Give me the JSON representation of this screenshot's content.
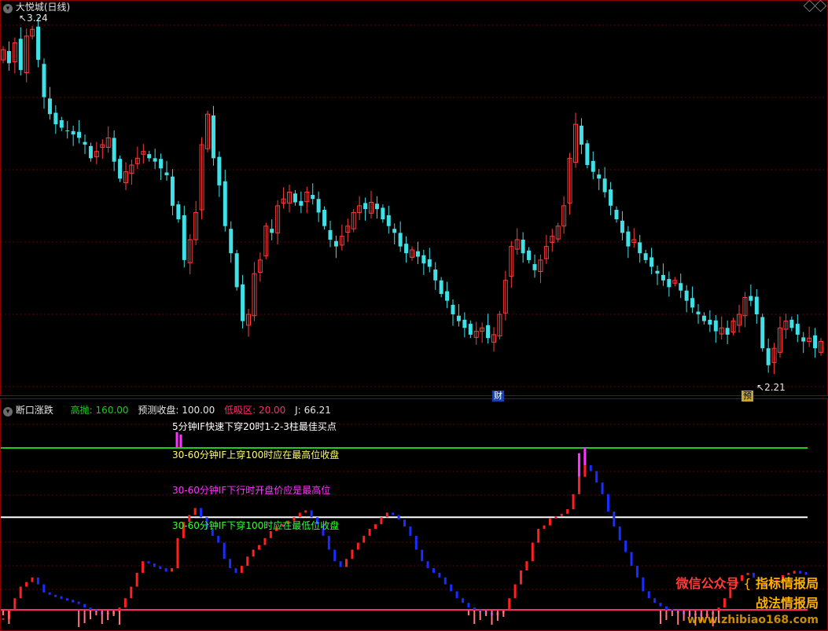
{
  "main_panel": {
    "title": "大悦城(日线)",
    "high_label": "3.24",
    "low_label": "2.21",
    "markers": [
      "财",
      "预"
    ]
  },
  "indicator_panel": {
    "title": "断口涨跌",
    "legend": [
      {
        "label": "高抛:",
        "value": "160.00",
        "color": "#1ecb1e"
      },
      {
        "label": "预测收盘:",
        "value": "100.00",
        "color": "#e6e6e6"
      },
      {
        "label": "低吸区:",
        "value": "20.00",
        "color": "#ff2a6e"
      },
      {
        "label": "J:",
        "value": "66.21",
        "color": "#e6e6e6"
      }
    ],
    "annotations": [
      {
        "text": "5分钟IF快速下穿20时1-2-3柱最佳买点",
        "color": "#ffffff"
      },
      {
        "text": "30-60分钟IF上穿100时应在最高位收盘",
        "color": "#ffff66"
      },
      {
        "text": "30-60分钟IF下行时开盘价应是最高位",
        "color": "#ff33ff"
      },
      {
        "text": "30-60分钟IF下穿100时应在最低位收盘",
        "color": "#33ff33"
      }
    ]
  },
  "watermark": {
    "line1_left": "微信公众号",
    "line1_right": "指标情报局",
    "line2": "战法情报局",
    "site": "www.zhibiao168.com"
  },
  "colors": {
    "up": "#ff3b3b",
    "down": "#3fe0e6",
    "panel_border": "#8b0000",
    "grid": "#6a0000"
  },
  "chart_data": [
    {
      "type": "candlestick",
      "title": "大悦城(日线)",
      "annotations": [
        "3.24",
        "2.21"
      ],
      "price_range": [
        2.18,
        3.28
      ],
      "series": [
        {
          "values": [
            3.18,
            3.14,
            3.2,
            3.12,
            3.22,
            3.24,
            3.15,
            3.04,
            2.99,
            2.96,
            2.95,
            2.94,
            2.93,
            2.92,
            2.9,
            2.86,
            2.88,
            2.9,
            2.92,
            2.85,
            2.8,
            2.82,
            2.84,
            2.86,
            2.88,
            2.86,
            2.85,
            2.83,
            2.81,
            2.72,
            2.68,
            2.56,
            2.62,
            2.7,
            2.9,
            2.99,
            2.86,
            2.78,
            2.66,
            2.58,
            2.48,
            2.38,
            2.4,
            2.52,
            2.56,
            2.66,
            2.64,
            2.72,
            2.74,
            2.76,
            2.73,
            2.72,
            2.76,
            2.74,
            2.7,
            2.66,
            2.62,
            2.6,
            2.63,
            2.66,
            2.7,
            2.72,
            2.71,
            2.73,
            2.71,
            2.68,
            2.66,
            2.64,
            2.6,
            2.58,
            2.59,
            2.57,
            2.55,
            2.54,
            2.5,
            2.46,
            2.44,
            2.4,
            2.38,
            2.36,
            2.34,
            2.35,
            2.36,
            2.33,
            2.34,
            2.4,
            2.5,
            2.6,
            2.62,
            2.58,
            2.56,
            2.53,
            2.56,
            2.6,
            2.63,
            2.66,
            2.72,
            2.86,
            2.96,
            2.9,
            2.84,
            2.82,
            2.8,
            2.76,
            2.72,
            2.68,
            2.64,
            2.6,
            2.62,
            2.58,
            2.56,
            2.54,
            2.52,
            2.5,
            2.48,
            2.5,
            2.47,
            2.44,
            2.42,
            2.4,
            2.38,
            2.37,
            2.35,
            2.36,
            2.34,
            2.38,
            2.4,
            2.45,
            2.44,
            2.4,
            2.3,
            2.25,
            2.3,
            2.36,
            2.38,
            2.36,
            2.34,
            2.32,
            2.33,
            2.3,
            2.32
          ]
        }
      ]
    },
    {
      "type": "bar",
      "title": "断口涨跌",
      "reference_lines": [
        160,
        100,
        20
      ],
      "series": [
        {
          "name": "J",
          "values": [
            12,
            20,
            30,
            40,
            44,
            48,
            42,
            35,
            33,
            31,
            30,
            28,
            27,
            25,
            22,
            20,
            18,
            17,
            17,
            18,
            22,
            30,
            40,
            52,
            62,
            60,
            57,
            56,
            53,
            56,
            82,
            96,
            102,
            108,
            100,
            90,
            84,
            78,
            64,
            56,
            52,
            58,
            66,
            72,
            76,
            82,
            88,
            92,
            94,
            97,
            100,
            104,
            106,
            100,
            94,
            84,
            72,
            62,
            57,
            64,
            72,
            78,
            84,
            90,
            94,
            100,
            104,
            102,
            98,
            92,
            84,
            72,
            62,
            56,
            52,
            48,
            42,
            36,
            30,
            26,
            22,
            20,
            18,
            17,
            16,
            17,
            20,
            30,
            42,
            54,
            62,
            78,
            90,
            93,
            99,
            101,
            103,
            107,
            120,
            135,
            145,
            140,
            130,
            120,
            105,
            92,
            80,
            70,
            58,
            48,
            36,
            30,
            26,
            23,
            20,
            19,
            18,
            17,
            16,
            16,
            15,
            16,
            18,
            22,
            30,
            40,
            45,
            50,
            52,
            48,
            44,
            40,
            42,
            46,
            50,
            52,
            53,
            52,
            51
          ]
        }
      ]
    }
  ]
}
